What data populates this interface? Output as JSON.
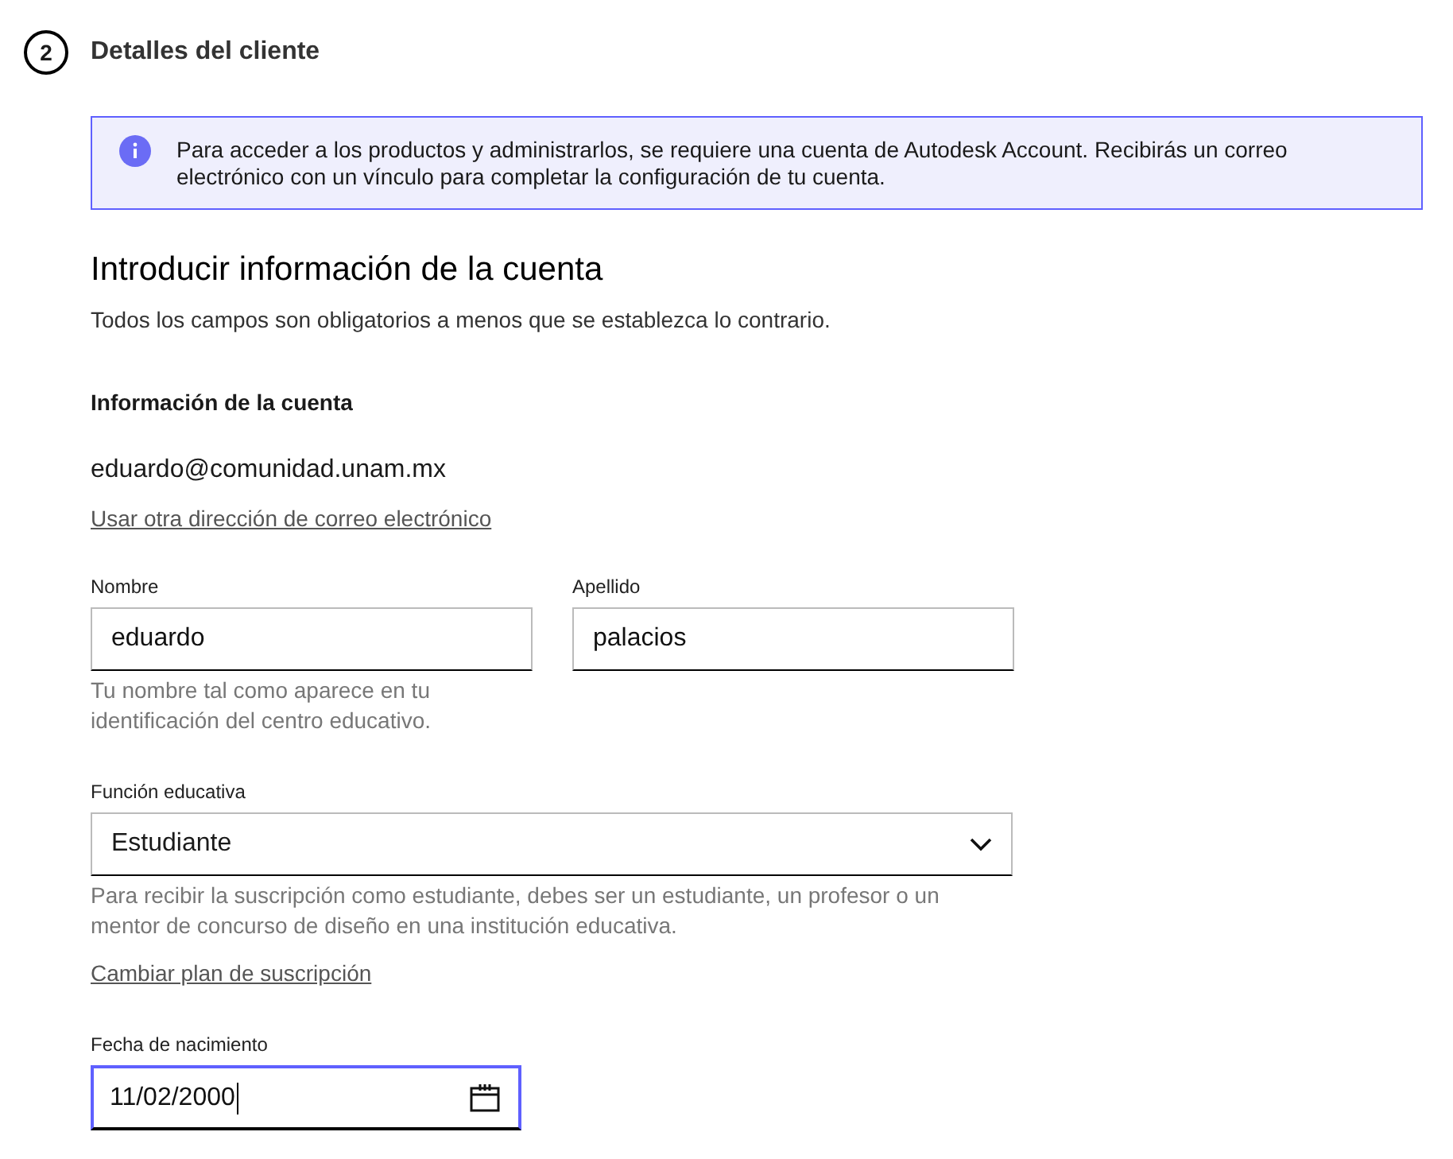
{
  "step": {
    "number": "2",
    "title": "Detalles del cliente"
  },
  "notice": {
    "text": "Para acceder a los productos y administrarlos, se requiere una cuenta de Autodesk Account. Recibirás un correo electrónico con un vínculo para completar la configuración de tu cuenta."
  },
  "heading": "Introducir información de la cuenta",
  "subheading": "Todos los campos son obligatorios a menos que se establezca lo contrario.",
  "section_title": "Información de la cuenta",
  "email": "eduardo@comunidad.unam.mx",
  "change_email_link": "Usar otra dirección de correo electrónico",
  "first_name": {
    "label": "Nombre",
    "value": "eduardo",
    "hint": "Tu nombre tal como aparece en tu identificación del centro educativo."
  },
  "last_name": {
    "label": "Apellido",
    "value": "palacios"
  },
  "role": {
    "label": "Función educativa",
    "value": "Estudiante",
    "hint": "Para recibir la suscripción como estudiante, debes ser un estudiante, un profesor o un mentor de concurso de diseño en una institución educativa."
  },
  "change_plan_link": "Cambiar plan de suscripción",
  "birth_date": {
    "label": "Fecha de nacimiento",
    "value": "11/02/2000",
    "focused": true
  }
}
